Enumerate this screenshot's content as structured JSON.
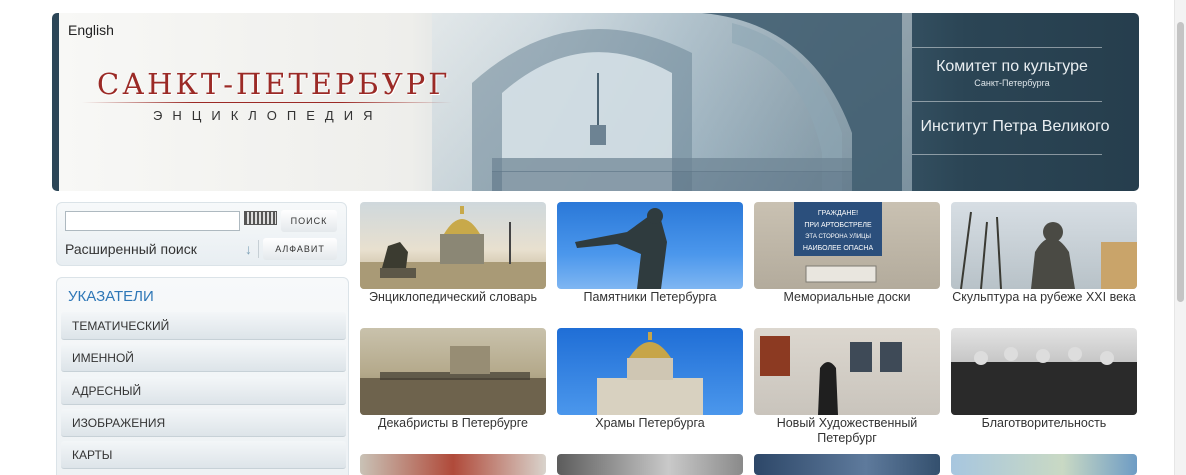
{
  "header": {
    "language_link": "English",
    "logo_title": "САНКТ-ПЕТЕРБУРГ",
    "logo_subtitle": "ЭНЦИКЛОПЕДИЯ",
    "committee": "Комитет по культуре",
    "committee_sub": "Санкт-Петербурга",
    "institute": "Институт Петра Великого"
  },
  "search": {
    "input_value": "",
    "keyboard_icon": "keyboard-icon",
    "search_button": "ПОИСК",
    "advanced_link": "Расширенный поиск",
    "arrow_icon": "arrow-down-icon",
    "alphabet_button": "АЛФАВИТ"
  },
  "index": {
    "title": "УКАЗАТЕЛИ",
    "items": [
      {
        "label": "ТЕМАТИЧЕСКИЙ"
      },
      {
        "label": "ИМЕННОЙ"
      },
      {
        "label": "АДРЕСНЫЙ"
      },
      {
        "label": "ИЗОБРАЖЕНИЯ"
      },
      {
        "label": "КАРТЫ"
      }
    ]
  },
  "tiles": [
    {
      "caption": "Энциклопедический словарь"
    },
    {
      "caption": "Памятники Петербурга"
    },
    {
      "caption": "Мемориальные доски"
    },
    {
      "caption": "Скульптура на рубеже XXI века"
    },
    {
      "caption": "Декабристы в Петербурге"
    },
    {
      "caption": "Храмы Петербурга"
    },
    {
      "caption": "Новый Художественный Петербург"
    },
    {
      "caption": "Благотворительность"
    }
  ],
  "plaque_text": "ГРАЖДАНЕ! ПРИ АРТОБСТРЕЛЕ ЭТА СТОРОНА УЛИЦЫ НАИБОЛЕЕ ОПАСНА",
  "colors": {
    "accent_red": "#9b2a26",
    "link_blue": "#2e77b7",
    "banner_dark": "#263e4d"
  }
}
